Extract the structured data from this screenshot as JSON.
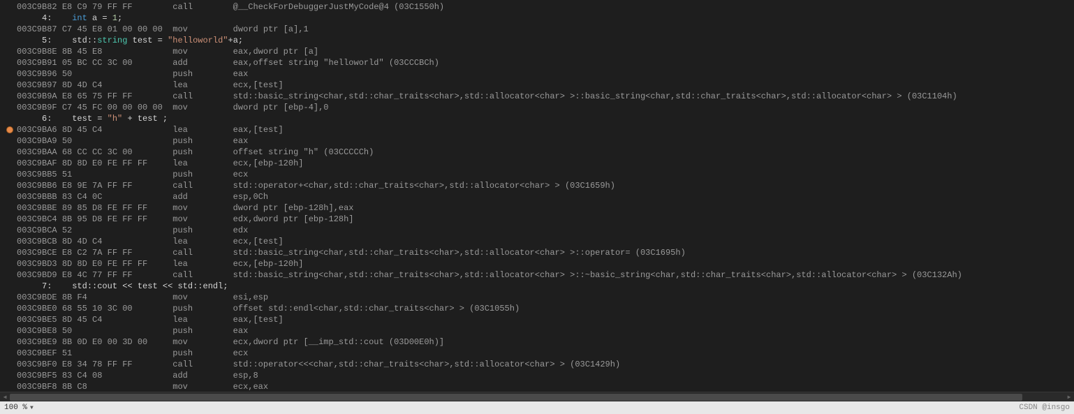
{
  "zoom": "100 %",
  "watermark": "CSDN @insgo",
  "lines": [
    {
      "type": "asm",
      "bp": false,
      "addr": "003C9B82",
      "bytes": "E8 C9 79 FF FF",
      "mnem": "call",
      "operand": "@__CheckForDebuggerJustMyCode@4 (03C1550h)"
    },
    {
      "type": "src",
      "num": "4:",
      "tokens": [
        {
          "t": "keyword",
          "v": "int"
        },
        {
          "t": "op",
          "v": " "
        },
        {
          "t": "ident",
          "v": "a"
        },
        {
          "t": "op",
          "v": " = "
        },
        {
          "t": "number",
          "v": "1"
        },
        {
          "t": "op",
          "v": ";"
        }
      ]
    },
    {
      "type": "asm",
      "bp": false,
      "addr": "003C9B87",
      "bytes": "C7 45 E8 01 00 00 00",
      "mnem": "mov",
      "operand": "dword ptr [a],1"
    },
    {
      "type": "src",
      "num": "5:",
      "tokens": [
        {
          "t": "ident",
          "v": "std"
        },
        {
          "t": "op",
          "v": "::"
        },
        {
          "t": "type",
          "v": "string"
        },
        {
          "t": "op",
          "v": " "
        },
        {
          "t": "ident",
          "v": "test"
        },
        {
          "t": "op",
          "v": " = "
        },
        {
          "t": "string",
          "v": "\"helloworld\""
        },
        {
          "t": "op",
          "v": "+"
        },
        {
          "t": "ident",
          "v": "a"
        },
        {
          "t": "op",
          "v": ";"
        }
      ]
    },
    {
      "type": "asm",
      "bp": false,
      "addr": "003C9B8E",
      "bytes": "8B 45 E8",
      "mnem": "mov",
      "operand": "eax,dword ptr [a]"
    },
    {
      "type": "asm",
      "bp": false,
      "addr": "003C9B91",
      "bytes": "05 BC CC 3C 00",
      "mnem": "add",
      "operand": "eax,offset string \"helloworld\" (03CCCBCh)"
    },
    {
      "type": "asm",
      "bp": false,
      "addr": "003C9B96",
      "bytes": "50",
      "mnem": "push",
      "operand": "eax"
    },
    {
      "type": "asm",
      "bp": false,
      "addr": "003C9B97",
      "bytes": "8D 4D C4",
      "mnem": "lea",
      "operand": "ecx,[test]"
    },
    {
      "type": "asm",
      "bp": false,
      "addr": "003C9B9A",
      "bytes": "E8 65 75 FF FF",
      "mnem": "call",
      "operand": "std::basic_string<char,std::char_traits<char>,std::allocator<char> >::basic_string<char,std::char_traits<char>,std::allocator<char> > (03C1104h)"
    },
    {
      "type": "asm",
      "bp": false,
      "addr": "003C9B9F",
      "bytes": "C7 45 FC 00 00 00 00",
      "mnem": "mov",
      "operand": "dword ptr [ebp-4],0"
    },
    {
      "type": "src",
      "num": "6:",
      "tokens": [
        {
          "t": "ident",
          "v": "test"
        },
        {
          "t": "op",
          "v": " = "
        },
        {
          "t": "string",
          "v": "\"h\""
        },
        {
          "t": "op",
          "v": " + "
        },
        {
          "t": "ident",
          "v": "test"
        },
        {
          "t": "op",
          "v": " ;"
        }
      ]
    },
    {
      "type": "asm",
      "bp": true,
      "addr": "003C9BA6",
      "bytes": "8D 45 C4",
      "mnem": "lea",
      "operand": "eax,[test]"
    },
    {
      "type": "asm",
      "bp": false,
      "addr": "003C9BA9",
      "bytes": "50",
      "mnem": "push",
      "operand": "eax"
    },
    {
      "type": "asm",
      "bp": false,
      "addr": "003C9BAA",
      "bytes": "68 CC CC 3C 00",
      "mnem": "push",
      "operand": "offset string \"h\" (03CCCCCh)"
    },
    {
      "type": "asm",
      "bp": false,
      "addr": "003C9BAF",
      "bytes": "8D 8D E0 FE FF FF",
      "mnem": "lea",
      "operand": "ecx,[ebp-120h]"
    },
    {
      "type": "asm",
      "bp": false,
      "addr": "003C9BB5",
      "bytes": "51",
      "mnem": "push",
      "operand": "ecx"
    },
    {
      "type": "asm",
      "bp": false,
      "addr": "003C9BB6",
      "bytes": "E8 9E 7A FF FF",
      "mnem": "call",
      "operand": "std::operator+<char,std::char_traits<char>,std::allocator<char> > (03C1659h)"
    },
    {
      "type": "asm",
      "bp": false,
      "addr": "003C9BBB",
      "bytes": "83 C4 0C",
      "mnem": "add",
      "operand": "esp,0Ch"
    },
    {
      "type": "asm",
      "bp": false,
      "addr": "003C9BBE",
      "bytes": "89 85 D8 FE FF FF",
      "mnem": "mov",
      "operand": "dword ptr [ebp-128h],eax"
    },
    {
      "type": "asm",
      "bp": false,
      "addr": "003C9BC4",
      "bytes": "8B 95 D8 FE FF FF",
      "mnem": "mov",
      "operand": "edx,dword ptr [ebp-128h]"
    },
    {
      "type": "asm",
      "bp": false,
      "addr": "003C9BCA",
      "bytes": "52",
      "mnem": "push",
      "operand": "edx"
    },
    {
      "type": "asm",
      "bp": false,
      "addr": "003C9BCB",
      "bytes": "8D 4D C4",
      "mnem": "lea",
      "operand": "ecx,[test]"
    },
    {
      "type": "asm",
      "bp": false,
      "addr": "003C9BCE",
      "bytes": "E8 C2 7A FF FF",
      "mnem": "call",
      "operand": "std::basic_string<char,std::char_traits<char>,std::allocator<char> >::operator= (03C1695h)"
    },
    {
      "type": "asm",
      "bp": false,
      "addr": "003C9BD3",
      "bytes": "8D 8D E0 FE FF FF",
      "mnem": "lea",
      "operand": "ecx,[ebp-120h]"
    },
    {
      "type": "asm",
      "bp": false,
      "addr": "003C9BD9",
      "bytes": "E8 4C 77 FF FF",
      "mnem": "call",
      "operand": "std::basic_string<char,std::char_traits<char>,std::allocator<char> >::~basic_string<char,std::char_traits<char>,std::allocator<char> > (03C132Ah)"
    },
    {
      "type": "src",
      "num": "7:",
      "tokens": [
        {
          "t": "ident",
          "v": "std"
        },
        {
          "t": "op",
          "v": "::"
        },
        {
          "t": "ident",
          "v": "cout"
        },
        {
          "t": "op",
          "v": " << "
        },
        {
          "t": "ident",
          "v": "test"
        },
        {
          "t": "op",
          "v": " << "
        },
        {
          "t": "ident",
          "v": "std"
        },
        {
          "t": "op",
          "v": "::"
        },
        {
          "t": "ident",
          "v": "endl"
        },
        {
          "t": "op",
          "v": ";"
        }
      ]
    },
    {
      "type": "asm",
      "bp": false,
      "addr": "003C9BDE",
      "bytes": "8B F4",
      "mnem": "mov",
      "operand": "esi,esp"
    },
    {
      "type": "asm",
      "bp": false,
      "addr": "003C9BE0",
      "bytes": "68 55 10 3C 00",
      "mnem": "push",
      "operand": "offset std::endl<char,std::char_traits<char> > (03C1055h)"
    },
    {
      "type": "asm",
      "bp": false,
      "addr": "003C9BE5",
      "bytes": "8D 45 C4",
      "mnem": "lea",
      "operand": "eax,[test]"
    },
    {
      "type": "asm",
      "bp": false,
      "addr": "003C9BE8",
      "bytes": "50",
      "mnem": "push",
      "operand": "eax"
    },
    {
      "type": "asm",
      "bp": false,
      "addr": "003C9BE9",
      "bytes": "8B 0D E0 00 3D 00",
      "mnem": "mov",
      "operand": "ecx,dword ptr [__imp_std::cout (03D00E0h)]"
    },
    {
      "type": "asm",
      "bp": false,
      "addr": "003C9BEF",
      "bytes": "51",
      "mnem": "push",
      "operand": "ecx"
    },
    {
      "type": "asm",
      "bp": false,
      "addr": "003C9BF0",
      "bytes": "E8 34 78 FF FF",
      "mnem": "call",
      "operand": "std::operator<<<char,std::char_traits<char>,std::allocator<char> > (03C1429h)"
    },
    {
      "type": "asm",
      "bp": false,
      "addr": "003C9BF5",
      "bytes": "83 C4 08",
      "mnem": "add",
      "operand": "esp,8"
    },
    {
      "type": "asm",
      "bp": false,
      "addr": "003C9BF8",
      "bytes": "8B C8",
      "mnem": "mov",
      "operand": "ecx,eax"
    }
  ]
}
